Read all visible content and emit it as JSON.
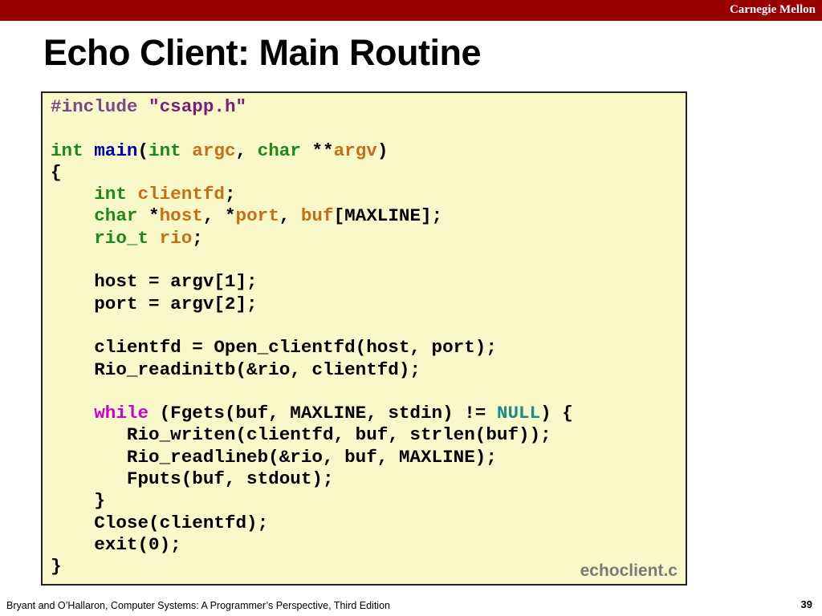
{
  "header": {
    "brand": "Carnegie Mellon",
    "bar_color": "#990000"
  },
  "slide": {
    "title": "Echo Client: Main Routine"
  },
  "code": {
    "filename": "echoclient.c",
    "background": "#f8f8c8",
    "lines": [
      "#include \"csapp.h\"",
      "",
      "int main(int argc, char **argv)",
      "{",
      "    int clientfd;",
      "    char *host, *port, buf[MAXLINE];",
      "    rio_t rio;",
      "",
      "    host = argv[1];",
      "    port = argv[2];",
      "",
      "    clientfd = Open_clientfd(host, port);",
      "    Rio_readinitb(&rio, clientfd);",
      "",
      "    while (Fgets(buf, MAXLINE, stdin) != NULL) {",
      "       Rio_writen(clientfd, buf, strlen(buf));",
      "       Rio_readlineb(&rio, buf, MAXLINE);",
      "       Fputs(buf, stdout);",
      "    }",
      "    Close(clientfd);",
      "    exit(0);",
      "}"
    ],
    "colors": {
      "keyword": "#1a8a1a",
      "function_name": "#0000b0",
      "variable": "#c86e14",
      "preprocessor": "#7a4a86",
      "control": "#cc00cc",
      "null": "#1a8a8a"
    }
  },
  "footer": {
    "credit": "Bryant and O’Hallaron, Computer Systems: A Programmer’s Perspective, Third Edition",
    "page": "39"
  }
}
